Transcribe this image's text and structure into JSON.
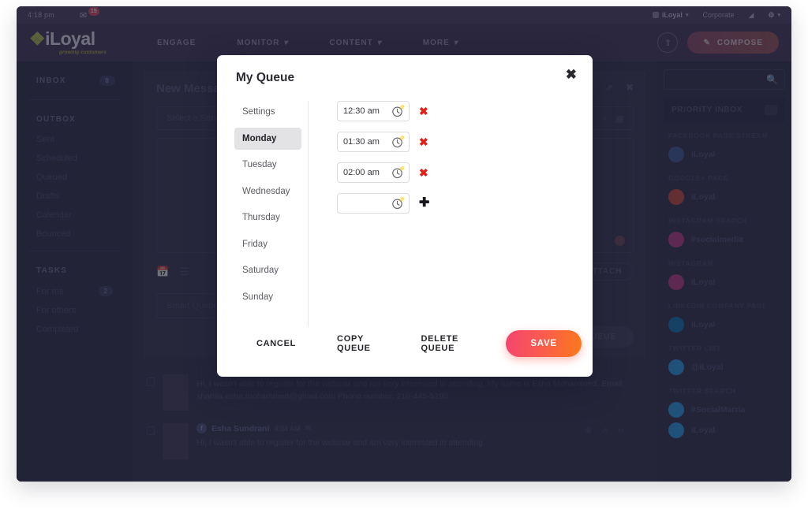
{
  "app": {
    "statusbar": {
      "time": "4:18 pm",
      "mail_icon": "mail-icon",
      "mail_badge": "15"
    },
    "account": {
      "name": "iLoyal",
      "org": "Corporate",
      "tools_icon": "tools-icon",
      "settings_icon": "gear-icon",
      "caret": "▾"
    },
    "logo": {
      "text": "iLoyal",
      "tagline": "growing customers"
    },
    "nav": [
      {
        "label": "ENGAGE",
        "has_caret": false
      },
      {
        "label": "MONITOR",
        "has_caret": true
      },
      {
        "label": "CONTENT",
        "has_caret": true
      },
      {
        "label": "MORE",
        "has_caret": true
      }
    ],
    "upload_icon": "upload-icon",
    "compose": {
      "label": "COMPOSE",
      "icon": "pencil-icon"
    }
  },
  "sidebar": {
    "inbox": {
      "label": "INBOX",
      "count": "0"
    },
    "outbox": {
      "label": "OUTBOX",
      "items": [
        {
          "label": "Sent"
        },
        {
          "label": "Scheduled"
        },
        {
          "label": "Queued"
        },
        {
          "label": "Drafts"
        },
        {
          "label": "Calendar"
        },
        {
          "label": "Bounced"
        }
      ]
    },
    "tasks": {
      "label": "TASKS",
      "items": [
        {
          "label": "For me",
          "count": "2"
        },
        {
          "label": "For others",
          "count": ""
        },
        {
          "label": "Completed",
          "count": ""
        }
      ]
    }
  },
  "compose_panel": {
    "title": "New Message",
    "expand_icon": "expand-icon",
    "close_icon": "close-icon",
    "service_placeholder": "Select a Service",
    "service_icons": [
      "close-icon",
      "pin-icon",
      "grid-icon"
    ],
    "toolbar_icons": [
      "calendar-icon",
      "list-icon"
    ],
    "attach": {
      "label": "ATTACH",
      "icon": "paperclip-icon"
    },
    "smart_queue_placeholder": "Smart Queue",
    "queue_button": "ADD TO QUEUE"
  },
  "messages": [
    {
      "name": "",
      "time": "",
      "text": "Hi, I wasn't able to register for the webinar and am very interested in attending. My name is Esha Mohammed. Email: shanila.esha.mohammed@gmail.com Phone number: 210-445-5190"
    },
    {
      "name": "Esha Sundrani",
      "time": "4:34 AM",
      "badge": "facebook-icon",
      "text": "Hi, I wasn't able to register for the webinar and am very interested in attending."
    }
  ],
  "right_panel": {
    "search_placeholder": "",
    "search_icon": "search-icon",
    "priority_inbox": {
      "label": "PRIORITY INBOX",
      "toggle_icon": "collapse-icon"
    },
    "streams": [
      {
        "group": "FACEBOOK PAGE STREAM",
        "label": "iLoyal",
        "icon": "facebook-icon",
        "color": "#3b5998"
      },
      {
        "group": "GOOGLE+ PAGE",
        "label": "iLoyal",
        "icon": "googleplus-icon",
        "color": "#d34836"
      },
      {
        "group": "INSTAGRAM SEARCH",
        "label": "#socialmedia",
        "icon": "instagram-icon",
        "color": "#c13584"
      },
      {
        "group": "INSTAGRAM",
        "label": "iLoyal",
        "icon": "instagram-icon",
        "color": "#c13584"
      },
      {
        "group": "LINKEDIN COMPANY PAGE",
        "label": "iLoyal",
        "icon": "linkedin-icon",
        "color": "#0077b5"
      },
      {
        "group": "TWITTER LIST",
        "label": "@iLoyal",
        "icon": "twitter-icon",
        "color": "#1da1f2"
      },
      {
        "group": "TWITTER SEARCH",
        "label": "#SocialMarria",
        "icon": "twitter-icon",
        "color": "#1da1f2"
      },
      {
        "group": "",
        "label": "iLoyal",
        "icon": "twitter-icon",
        "color": "#1da1f2"
      }
    ]
  },
  "modal": {
    "title": "My Queue",
    "close_icon": "close-icon",
    "days": [
      {
        "label": "Settings",
        "active": false
      },
      {
        "label": "Monday",
        "active": true
      },
      {
        "label": "Tuesday",
        "active": false
      },
      {
        "label": "Wednesday",
        "active": false
      },
      {
        "label": "Thursday",
        "active": false
      },
      {
        "label": "Friday",
        "active": false
      },
      {
        "label": "Saturday",
        "active": false
      },
      {
        "label": "Sunday",
        "active": false
      }
    ],
    "slots": [
      {
        "time": "12:30 am",
        "action": "remove",
        "action_glyph": "✖"
      },
      {
        "time": "01:30 am",
        "action": "remove",
        "action_glyph": "✖"
      },
      {
        "time": "02:00 am",
        "action": "remove",
        "action_glyph": "✖"
      },
      {
        "time": "",
        "action": "add",
        "action_glyph": "✚"
      }
    ],
    "buttons": {
      "cancel": "CANCEL",
      "copy": "COPY QUEUE",
      "delete": "DELETE QUEUE",
      "save": "SAVE"
    },
    "save_gradient": [
      "#f4446e",
      "#fb7a18"
    ]
  }
}
